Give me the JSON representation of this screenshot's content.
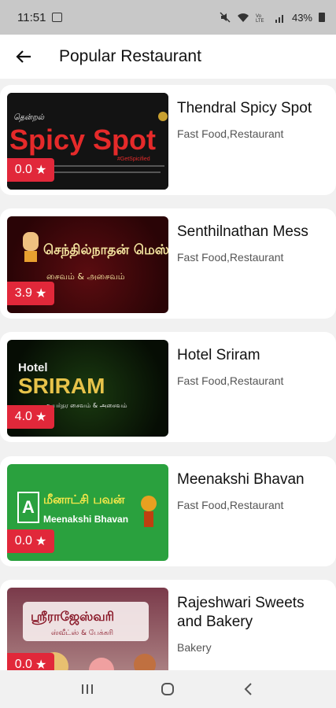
{
  "status_bar": {
    "time": "11:51",
    "battery": "43%"
  },
  "app_bar": {
    "title": "Popular Restaurant"
  },
  "restaurants": [
    {
      "name": "Thendral Spicy Spot",
      "category": "Fast Food,Restaurant",
      "rating": "0.0",
      "thumb_text": "Spicy Spot",
      "thumb_sub": "#GetSpicified"
    },
    {
      "name": "Senthilnathan Mess",
      "category": "Fast Food,Restaurant",
      "rating": "3.9",
      "thumb_text": "செந்தில்நாதன் மெஸ்",
      "thumb_sub": "சைவம் & அசைவம்"
    },
    {
      "name": "Hotel Sriram",
      "category": "Fast Food,Restaurant",
      "rating": "4.0",
      "thumb_text": "SRIRAM",
      "thumb_small": "Hotel",
      "thumb_sub": "உயர்தர சைவம் & அசைவம்"
    },
    {
      "name": "Meenakshi Bhavan",
      "category": "Fast Food,Restaurant",
      "rating": "0.0",
      "thumb_text": "மீனாட்சி பவன்",
      "thumb_sub": "Meenakshi Bhavan"
    },
    {
      "name": "Rajeshwari Sweets and Bakery",
      "category": "Bakery",
      "rating": "0.0",
      "thumb_text": "ஸ்ரீராஜேஸ்வரி",
      "thumb_sub": "ஸ்வீட்ஸ் & பேக்கரி"
    }
  ],
  "colors": {
    "rating_bg": "#e1283a",
    "accent_spicy": "#e52a2a"
  }
}
